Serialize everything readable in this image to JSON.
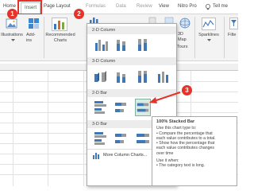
{
  "ribbon": {
    "tabs": [
      "Home",
      "Insert",
      "Page Layout",
      "Formulas",
      "Data",
      "Review",
      "View",
      "Nitro Pro",
      "Tell me"
    ],
    "illustrations": "Illustrations",
    "addins": "Add-\nins",
    "recommended": "Recommended\nCharts",
    "map3d": "3D\nMap",
    "tours": "Tours",
    "sparklines": "Sparklines",
    "filters": "Filte"
  },
  "dropdown": {
    "sections": [
      "2-D Column",
      "3-D Column",
      "2-D Bar",
      "3-D Bar"
    ],
    "more": "More Column Charts..."
  },
  "tooltip": {
    "title": "100% Stacked Bar",
    "use": "Use this chart type to:",
    "b1a": "• Compare the percentage that",
    "b1b": "  each value contributes to a total.",
    "b2a": "• Show how the percentage that",
    "b2b": "  each value contributes changes",
    "b2c": "  over time",
    "usewhen": "Use it when:",
    "b3": "• The category text is long."
  },
  "badges": [
    "1",
    "2",
    "3"
  ],
  "colors": {
    "accent": "#217346",
    "badge": "#e5332a",
    "select": "#d9ebe3"
  }
}
